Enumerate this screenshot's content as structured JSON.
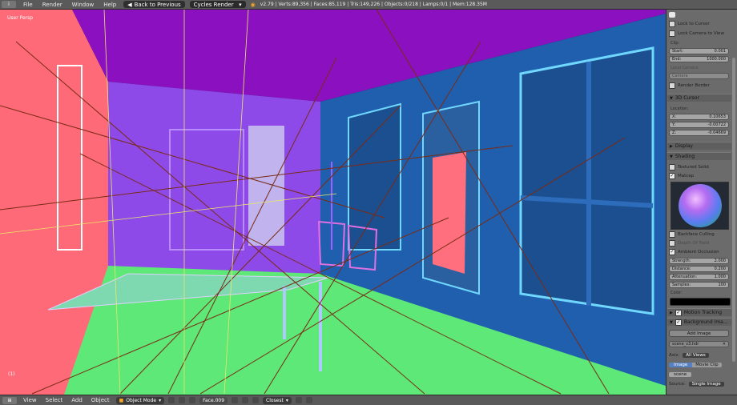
{
  "topbar": {
    "menus": [
      "File",
      "Render",
      "Window",
      "Help"
    ],
    "back_button": "Back to Previous",
    "engine": "Cycles Render",
    "stats": "v2.79 | Verts:89,356 | Faces:85,119 | Tris:149,226 | Objects:0/218 | Lamps:0/1 | Mem:128.35M"
  },
  "viewport": {
    "view_label": "User Persp",
    "frame_label": "(1)"
  },
  "properties": {
    "lock_to_cursor": "Lock to Cursor",
    "lock_camera_to_view": "Lock Camera to View",
    "clip_label": "Clip:",
    "clip_start_label": "Start:",
    "clip_start_value": "0.001",
    "clip_end_label": "End:",
    "clip_end_value": "1000.000",
    "local_camera_label": "Local Camera:",
    "local_camera_value": "Camera",
    "render_border": "Render Border",
    "cursor_panel": "3D Cursor",
    "location_label": "Location:",
    "cursor_x_label": "X:",
    "cursor_x_value": "0.10653",
    "cursor_y_label": "Y:",
    "cursor_y_value": "-0.00722",
    "cursor_z_label": "Z:",
    "cursor_z_value": "-0.04669",
    "display_panel": "Display",
    "shading_panel": "Shading",
    "textured_solid": "Textured Solid",
    "matcap": "Matcap",
    "backface_culling": "Backface Culling",
    "depth_of_field": "Depth Of Field",
    "ambient_occlusion": "Ambient Occlusion",
    "strength_label": "Strength:",
    "strength_value": "2.000",
    "distance_label": "Distance:",
    "distance_value": "0.200",
    "attenuation_label": "Attenuation:",
    "attenuation_value": "1.000",
    "samples_label": "Samples:",
    "samples_value": "100",
    "color_label": "Color:",
    "motion_tracking": "Motion Tracking",
    "background_images": "Background Ima...",
    "add_image": "Add Image",
    "image_name": "scene_v3.hdr",
    "axis_label": "Axis:",
    "axis_value": "All Views",
    "image_tab": "Image",
    "movie_clip_tab": "Movie Clip",
    "image_file": "scene",
    "source_label": "Source:",
    "source_value": "Single Image"
  },
  "bottombar": {
    "menus": [
      "View",
      "Select",
      "Add",
      "Object"
    ],
    "mode": "Object Mode",
    "selected_object": "Face.009",
    "snap": "Closest"
  },
  "colors": {
    "floor": "#5ee878",
    "back_wall": "#8d4ae8",
    "right_wall": "#1f5fae",
    "ceiling": "#8a10c0",
    "left_wall": "#ff6a78",
    "door": "#ff6f7d"
  }
}
